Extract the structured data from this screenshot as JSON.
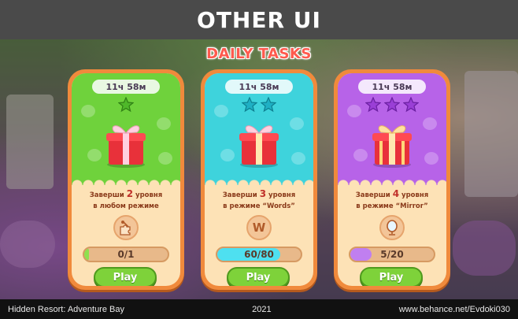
{
  "header": {
    "title": "OTHER UI"
  },
  "section": {
    "title": "DAILY TASKS"
  },
  "colors": {
    "card_border": "#f08a3c",
    "card_body": "#fde2b6",
    "green": "#6fd23c",
    "cyan": "#3ed3dc",
    "purple": "#b763e8",
    "play_button": "#7ed23a",
    "title_red": "#ff5a4e"
  },
  "cards": [
    {
      "timer": "11ч 58м",
      "stars": 1,
      "task_prefix": "Заверши",
      "task_number": "2",
      "task_suffix": "уровня",
      "task_line2": "в любом режиме",
      "mode_icon": "mode-any-icon",
      "progress_label": "0/1",
      "progress_fraction": 0.02,
      "play_label": "Play"
    },
    {
      "timer": "11ч 58м",
      "stars": 2,
      "task_prefix": "Заверши",
      "task_number": "3",
      "task_suffix": "уровня",
      "task_line2": "в режиме “Words”",
      "mode_icon": "words-mode-icon",
      "mode_glyph": "W",
      "progress_label": "60/80",
      "progress_fraction": 0.75,
      "play_label": "Play"
    },
    {
      "timer": "11ч 58м",
      "stars": 3,
      "task_prefix": "Заверши",
      "task_number": "4",
      "task_suffix": "уровня",
      "task_line2": "в режиме “Mirror”",
      "mode_icon": "mirror-mode-icon",
      "progress_label": "5/20",
      "progress_fraction": 0.25,
      "play_label": "Play"
    }
  ],
  "footer": {
    "game": "Hidden Resort: Adventure Bay",
    "year": "2021",
    "credit": "www.behance.net/Evdoki030"
  }
}
